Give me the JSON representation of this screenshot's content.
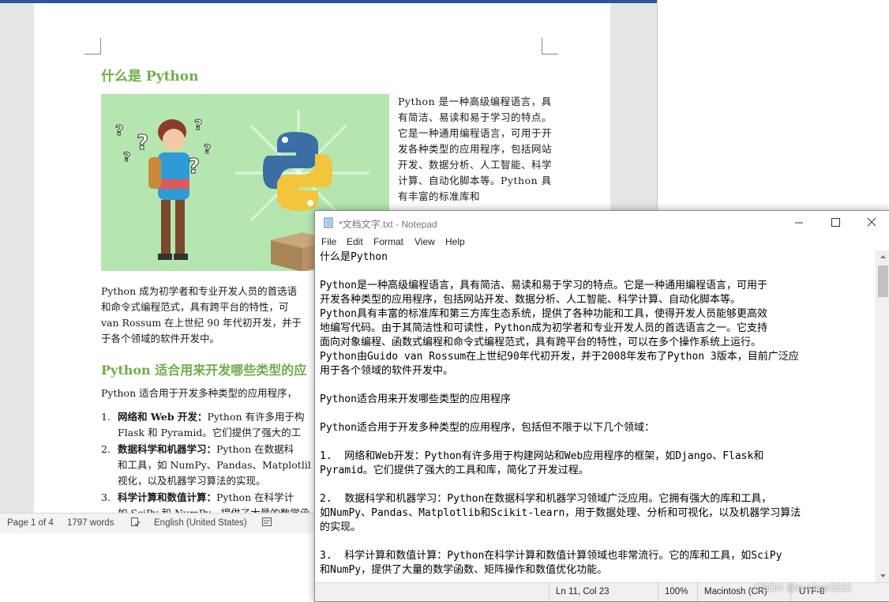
{
  "word": {
    "heading1": "什么是 Python",
    "side_text": "Python 是一种高级编程语言，具有简洁、易读和易于学习的特点。它是一种通用编程语言，可用于开发各种类型的应用程序，包括网站开发、数据分析、人工智能、科学计算、自动化脚本等。Python 具有丰富的标准库和",
    "para2_lines": [
      "Python 成为初学者和专业开发人员的首选语",
      "和命令式编程范式，具有跨平台的特性，可",
      "van Rossum 在上世纪 90 年代初开发，并于",
      "于各个领域的软件开发中。"
    ],
    "heading2": "Python 适合用来开发哪些类型的应",
    "para3": "Python 适合用于开发多种类型的应用程序，",
    "list": [
      {
        "num": "1.",
        "bold": "网络和 Web 开发：",
        "lines": [
          "Python 有许多用于构",
          "Flask 和 Pyramid。它们提供了强大的工"
        ]
      },
      {
        "num": "2.",
        "bold": "数据科学和机器学习：",
        "lines": [
          "Python 在数据科",
          "和工具，如 NumPy、Pandas、Matplotlil",
          "视化，以及机器学习算法的实现。"
        ]
      },
      {
        "num": "3.",
        "bold": "科学计算和数值计算：",
        "lines": [
          "Python 在科学计",
          "如 SciPy 和 NumPy，提供了大量的数学函"
        ]
      }
    ],
    "status": {
      "page": "Page 1 of 4",
      "words": "1797 words",
      "language": "English (United States)"
    },
    "colors": {
      "accent": "#2b579a",
      "heading": "#70ad47",
      "image_bg": "#b5e6b0"
    }
  },
  "notepad": {
    "title": "*文档文字.txt - Notepad",
    "menu": [
      "File",
      "Edit",
      "Format",
      "View",
      "Help"
    ],
    "content": "什么是Python\n\nPython是一种高级编程语言，具有简洁、易读和易于学习的特点。它是一种通用编程语言，可用于\n开发各种类型的应用程序，包括网站开发、数据分析、人工智能、科学计算、自动化脚本等。\nPython具有丰富的标准库和第三方库生态系统，提供了各种功能和工具，使得开发人员能够更高效\n地编写代码。由于其简洁性和可读性，Python成为初学者和专业开发人员的首选语言之一。它支持\n面向对象编程、函数式编程和命令式编程范式，具有跨平台的特性，可以在多个操作系统上运行。\nPython由Guido van Rossum在上世纪90年代初开发，并于2008年发布了Python 3版本，目前广泛应\n用于各个领域的软件开发中。\n\nPython适合用来开发哪些类型的应用程序\n\nPython适合用于开发多种类型的应用程序，包括但不限于以下几个领域：\n\n1.  网络和Web开发：Python有许多用于构建网站和Web应用程序的框架，如Django、Flask和\nPyramid。它们提供了强大的工具和库，简化了开发过程。\n\n2.  数据科学和机器学习：Python在数据科学和机器学习领域广泛应用。它拥有强大的库和工具，\n如NumPy、Pandas、Matplotlib和Scikit-learn，用于数据处理、分析和可视化，以及机器学习算法\n的实现。\n\n3.  科学计算和数值计算：Python在科学计算和数值计算领域也非常流行。它的库和工具，如SciPy\n和NumPy，提供了大量的数学函数、矩阵操作和数值优化功能。",
    "status": {
      "position": "Ln 11, Col 23",
      "zoom": "100%",
      "line_ending": "Macintosh (CR)",
      "encoding": "UTF-8"
    }
  },
  "watermark": "CSDN @nuclear2011"
}
